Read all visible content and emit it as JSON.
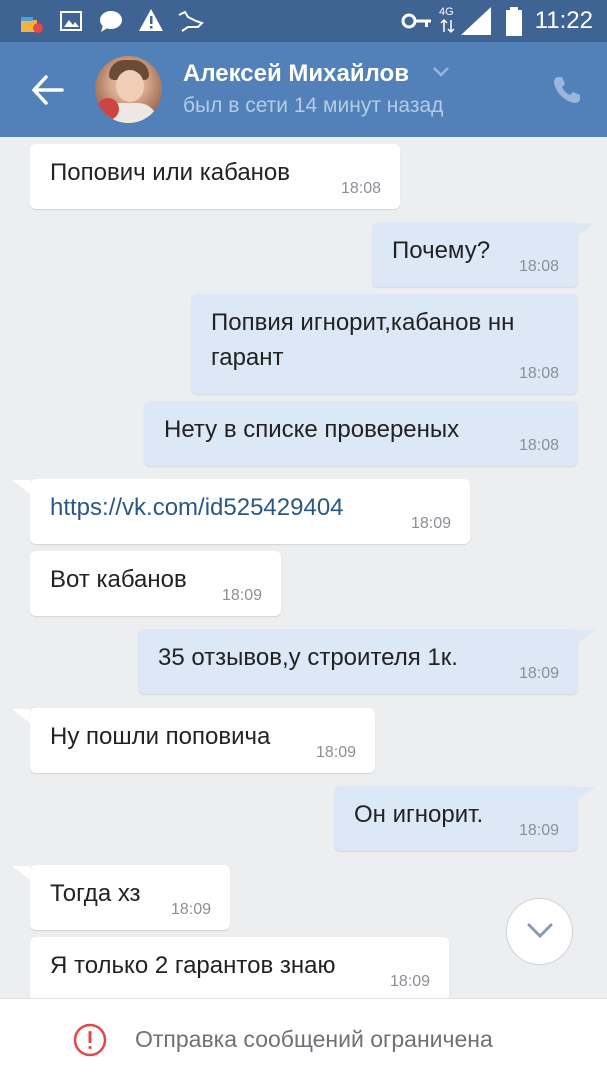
{
  "status_bar": {
    "time": "11:22",
    "network": "4G"
  },
  "header": {
    "contact_name": "Алексей Михайлов",
    "last_seen": "был в сети 14 минут назад"
  },
  "messages": [
    {
      "text": "Попович или кабанов",
      "time": "18:08",
      "direction": "incoming"
    },
    {
      "text": "Почему?",
      "time": "18:08",
      "direction": "outgoing"
    },
    {
      "text": "Попвия игнорит,кабанов нн",
      "text2": "гарант",
      "time": "18:08",
      "direction": "outgoing"
    },
    {
      "text": "Нету в списке провереных",
      "time": "18:08",
      "direction": "outgoing"
    },
    {
      "text": "https://vk.com/id525429404",
      "time": "18:09",
      "direction": "incoming"
    },
    {
      "text": "Вот кабанов",
      "time": "18:09",
      "direction": "incoming"
    },
    {
      "text": "35 отзывов,у строителя 1к.",
      "time": "18:09",
      "direction": "outgoing"
    },
    {
      "text": "Ну пошли поповича",
      "time": "18:09",
      "direction": "incoming"
    },
    {
      "text": "Он игнорит.",
      "time": "18:09",
      "direction": "outgoing"
    },
    {
      "text": "Тогда хз",
      "time": "18:09",
      "direction": "incoming"
    },
    {
      "text": "Я только 2 гарантов знаю",
      "time": "18:09",
      "direction": "incoming"
    }
  ],
  "footer": {
    "notice": "Отправка сообщений ограничена",
    "notice_icon": "error-circle-icon"
  },
  "colors": {
    "status_bar": "#3f6494",
    "header": "#5181b8",
    "background": "#edeef0",
    "incoming_bubble": "#ffffff",
    "outgoing_bubble": "#dce8f6",
    "link": "#2a5885",
    "warning": "#e64646"
  }
}
